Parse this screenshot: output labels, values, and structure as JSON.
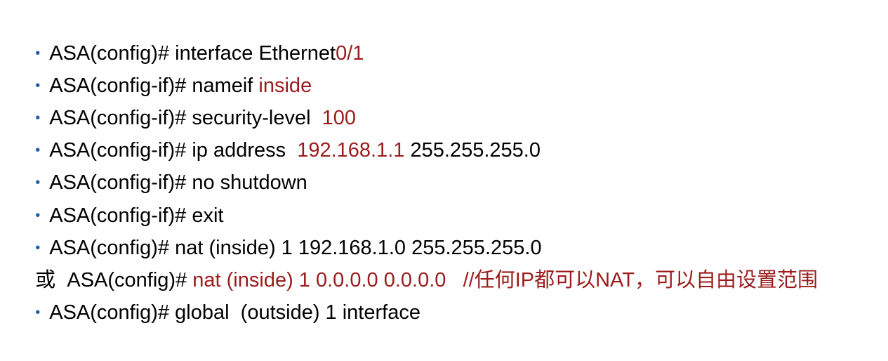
{
  "bullet_char": "•",
  "lines": [
    {
      "prompt": "ASA(config)# ",
      "command": "interface Ethernet",
      "highlight": "0/1"
    },
    {
      "prompt": "ASA(config-if)# ",
      "command": "nameif ",
      "highlight": "inside"
    },
    {
      "prompt": "ASA(config-if)# ",
      "command": "security-level  ",
      "highlight": "100"
    },
    {
      "prompt": "ASA(config-if)# ",
      "command": "ip address  ",
      "highlight": "192.168.1.1",
      "tail": " 255.255.255.0"
    },
    {
      "prompt": "ASA(config-if)# ",
      "command": "no shutdown"
    },
    {
      "prompt": "ASA(config-if)# ",
      "command": "exit"
    },
    {
      "prompt": "ASA(config)# ",
      "command": "nat (inside) 1 192.168.1.0 255.255.255.0"
    },
    {
      "lead": "或  ",
      "prompt": "ASA(config)# ",
      "highlight": "nat (inside) 1 0.0.0.0 0.0.0.0   //任何IP都可以NAT，可以自由设置范围"
    },
    {
      "prompt": "ASA(config)# ",
      "command": "global  (outside) 1 interface"
    }
  ],
  "colors": {
    "bullet": "#1f5fa8",
    "highlight": "#9b1c1c",
    "text": "#000000"
  }
}
